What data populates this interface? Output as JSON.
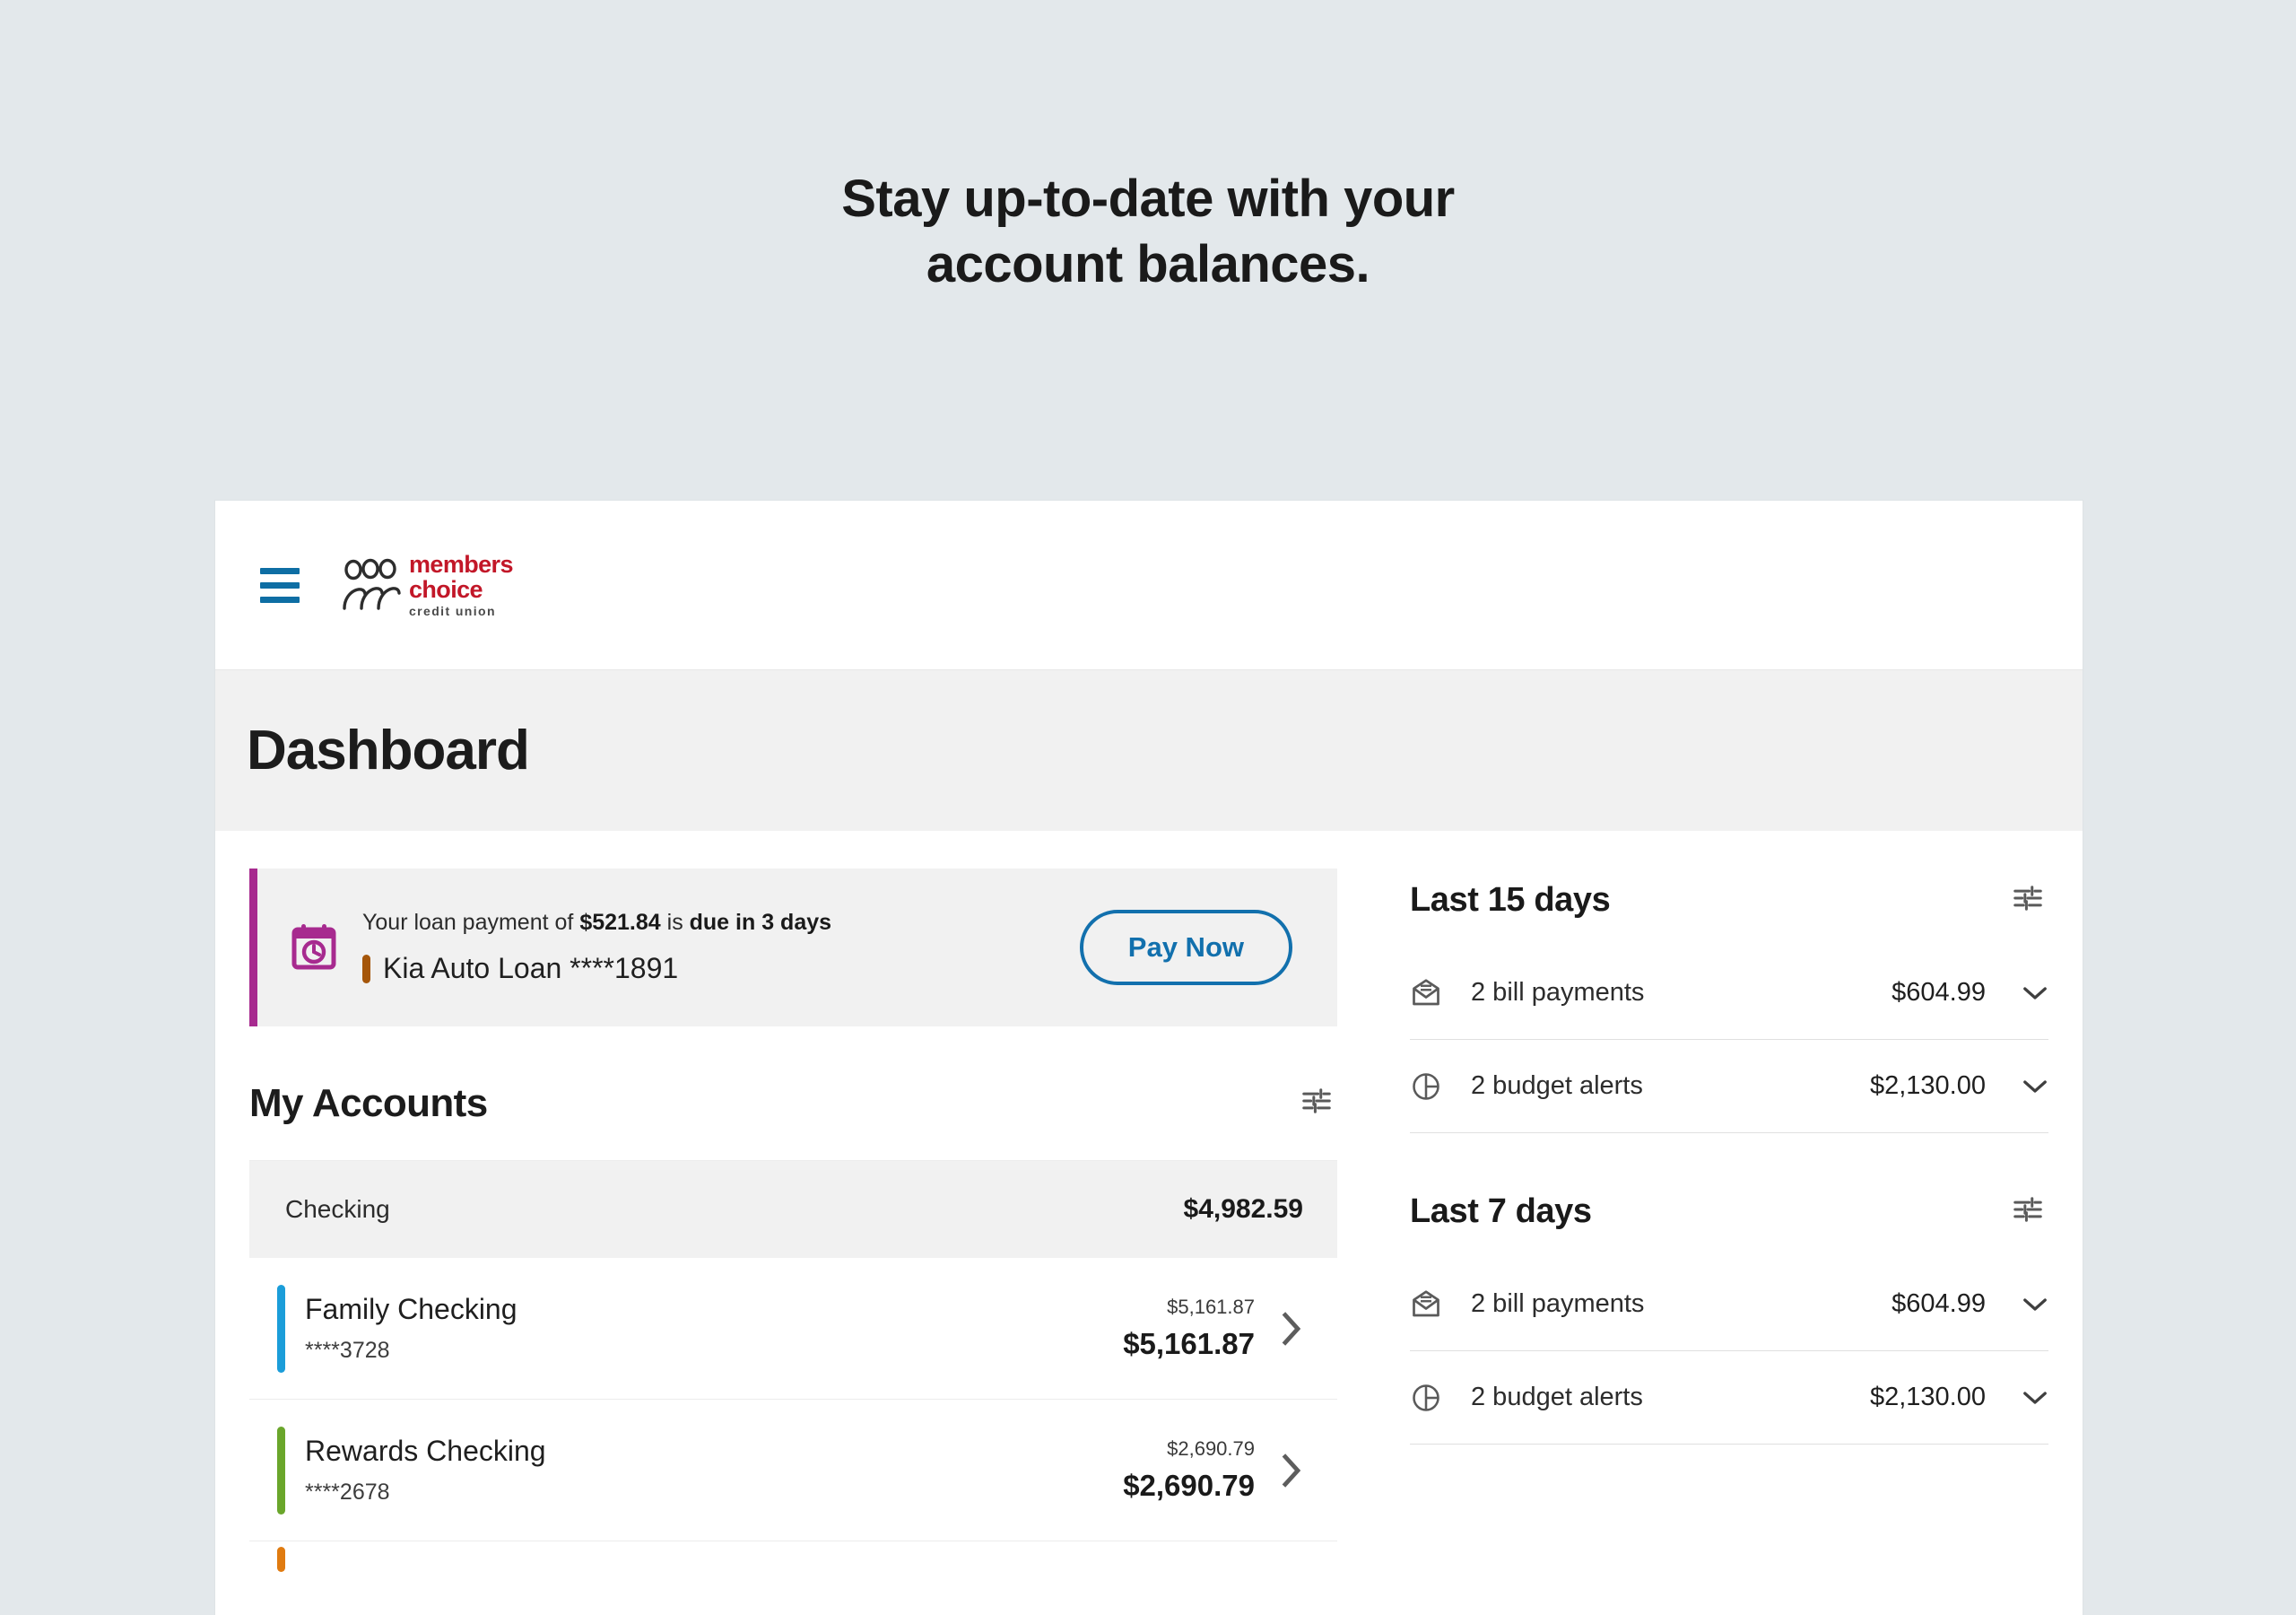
{
  "hero": {
    "line1": "Stay up-to-date with your",
    "line2": "account balances."
  },
  "header": {
    "menu_icon": "hamburger-menu-icon",
    "logo": {
      "line1": "members",
      "line2": "choice",
      "line3": "credit union",
      "brand_color": "#c21728",
      "figures_icon": "three-people-icon"
    }
  },
  "page": {
    "title": "Dashboard"
  },
  "alert": {
    "icon": "calendar-clock-icon",
    "accent_color": "#a72a8f",
    "text_prefix": "Your loan payment of ",
    "amount": "$521.84",
    "text_middle": " is ",
    "due_text": "due in 3 days",
    "loan_name": "Kia Auto Loan ****1891",
    "loan_bar_color": "#a5560a",
    "pay_button": "Pay Now",
    "pay_button_color": "#1270ad"
  },
  "accounts_section": {
    "title": "My Accounts",
    "filter_icon": "tune-sliders-icon",
    "group": {
      "name": "Checking",
      "total": "$4,982.59"
    },
    "rows": [
      {
        "name": "Family Checking",
        "number": "****3728",
        "available": "$5,161.87",
        "balance": "$5,161.87",
        "accent_color": "#1b9dd9",
        "chevron": "chevron-right-icon"
      },
      {
        "name": "Rewards Checking",
        "number": "****2678",
        "available": "$2,690.79",
        "balance": "$2,690.79",
        "accent_color": "#6aa62b",
        "chevron": "chevron-right-icon"
      }
    ],
    "next_row_accent_color": "#e07b10"
  },
  "activity": {
    "panels": [
      {
        "title": "Last 15 days",
        "filter_icon": "tune-sliders-icon",
        "rows": [
          {
            "icon": "bill-payment-envelope-icon",
            "label": "2 bill payments",
            "amount": "$604.99",
            "chevron": "chevron-down-icon"
          },
          {
            "icon": "budget-pie-chart-icon",
            "label": "2 budget alerts",
            "amount": "$2,130.00",
            "chevron": "chevron-down-icon"
          }
        ]
      },
      {
        "title": "Last 7 days",
        "filter_icon": "tune-sliders-icon",
        "rows": [
          {
            "icon": "bill-payment-envelope-icon",
            "label": "2 bill payments",
            "amount": "$604.99",
            "chevron": "chevron-down-icon"
          },
          {
            "icon": "budget-pie-chart-icon",
            "label": "2 budget alerts",
            "amount": "$2,130.00",
            "chevron": "chevron-down-icon"
          }
        ]
      }
    ]
  }
}
